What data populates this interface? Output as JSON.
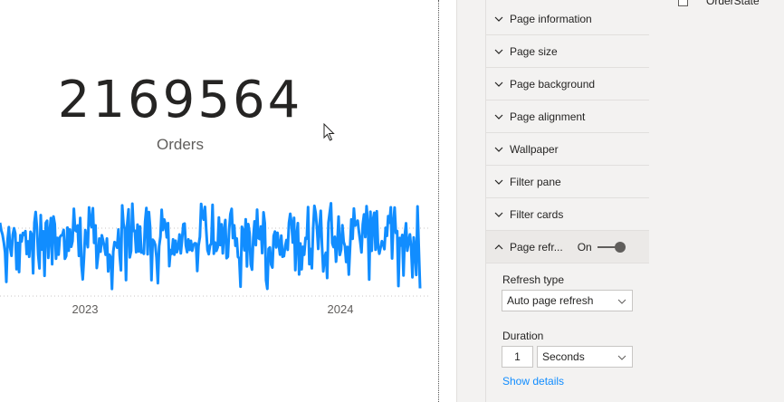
{
  "report": {
    "kpi_value": "2169564",
    "kpi_label": "Orders",
    "chart_data": {
      "type": "line",
      "x_tick_labels": [
        "2023",
        "2024"
      ],
      "series_color": "#118dff"
    }
  },
  "format_pane": {
    "sections": [
      {
        "label": "Page information"
      },
      {
        "label": "Page size"
      },
      {
        "label": "Page background"
      },
      {
        "label": "Page alignment"
      },
      {
        "label": "Wallpaper"
      },
      {
        "label": "Filter pane"
      },
      {
        "label": "Filter cards"
      }
    ],
    "page_refresh": {
      "label": "Page refr...",
      "toggle_text": "On",
      "refresh_type_label": "Refresh type",
      "refresh_type_value": "Auto page refresh",
      "duration_label": "Duration",
      "duration_value": "1",
      "duration_unit": "Seconds",
      "show_details": "Show details"
    }
  },
  "fields_pane": {
    "field_label": "OrderState"
  },
  "colors": {
    "accent": "#118dff",
    "pane_bg": "#f3f2f1"
  }
}
